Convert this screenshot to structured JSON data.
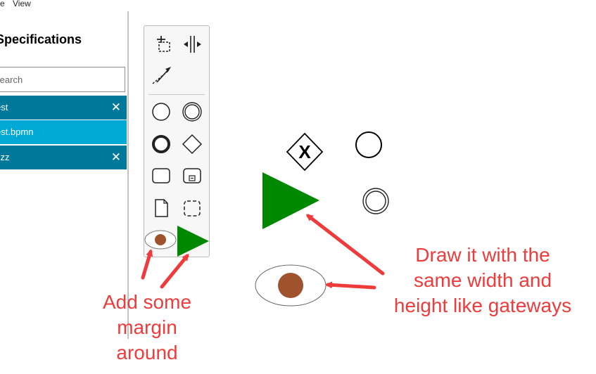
{
  "menubar": {
    "file_label": "e",
    "view_label": "View"
  },
  "sidebar": {
    "title": "Specifications",
    "search_placeholder": "Search",
    "items": [
      {
        "label": "est",
        "close_glyph": "✕",
        "color": "#00789a"
      },
      {
        "label": "est.bpmn",
        "color": "#00a8d6"
      },
      {
        "label": "zzz",
        "close_glyph": "✕",
        "color": "#00789a"
      }
    ]
  },
  "palette": {
    "tools": [
      "create-space-icon",
      "lasso-tool-icon",
      "global-connect-icon",
      "start-event-icon",
      "intermediate-event-icon",
      "end-event-icon",
      "gateway-icon",
      "task-icon",
      "subprocess-icon",
      "data-object-icon",
      "group-icon",
      "eye-icon",
      "play-triangle-icon"
    ]
  },
  "canvas": {
    "shapes": [
      "exclusive-gateway",
      "start-event",
      "play-triangle",
      "intermediate-event",
      "eye-shape"
    ],
    "gateway_glyph": "X"
  },
  "annotations": {
    "left_lines": [
      "Add some",
      "margin",
      "around"
    ],
    "right_lines": [
      "Draw it with the",
      "same width and",
      "height like gateways"
    ]
  },
  "colors": {
    "accent_dark": "#00789a",
    "accent_light": "#00a8d6",
    "triangle_green": "#008800",
    "eye_brown": "#a0522d",
    "annotation_red": "#ee3b3b"
  }
}
